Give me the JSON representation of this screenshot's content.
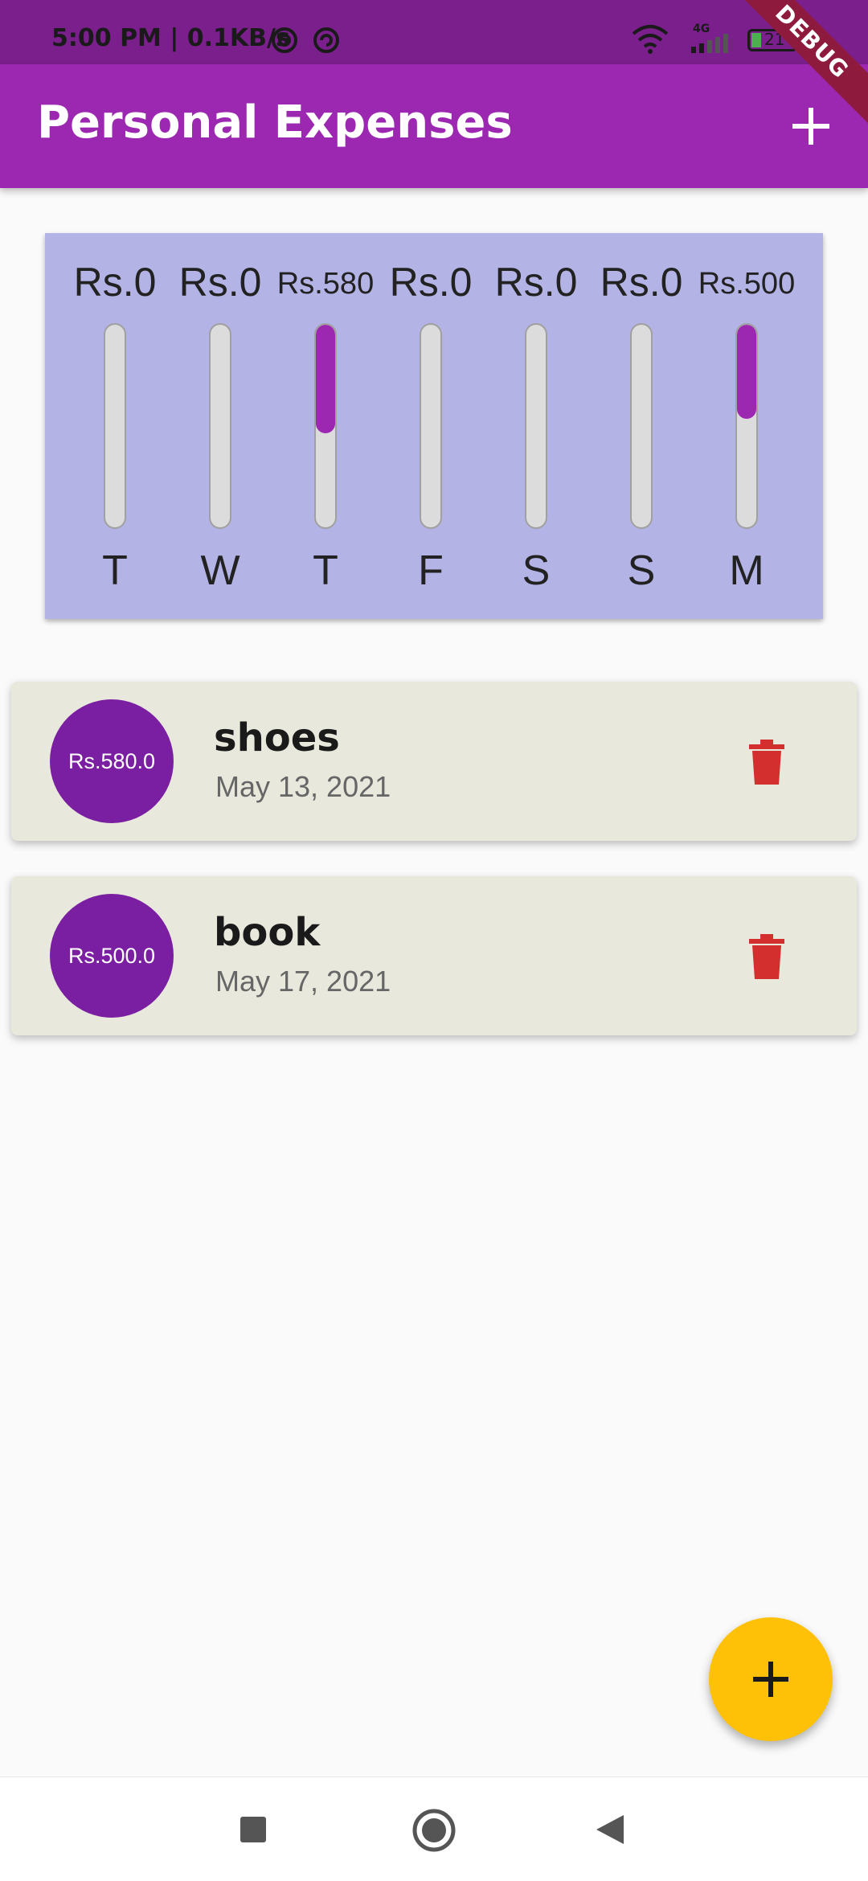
{
  "status_bar": {
    "time": "5:00 PM | 0.1KB/s",
    "network": "4G",
    "battery": "21",
    "icons": [
      "vpn-icon",
      "sync-icon",
      "wifi-icon",
      "signal-icon",
      "battery-icon"
    ]
  },
  "debug_banner": "DEBUG",
  "app_bar": {
    "title": "Personal Expenses",
    "add_icon": "plus-icon"
  },
  "chart": {
    "bars": [
      {
        "day": "T",
        "amount": "Rs.0",
        "value": 0,
        "fraction": 0
      },
      {
        "day": "W",
        "amount": "Rs.0",
        "value": 0,
        "fraction": 0
      },
      {
        "day": "T",
        "amount": "Rs.580",
        "value": 580,
        "fraction": 0.537
      },
      {
        "day": "F",
        "amount": "Rs.0",
        "value": 0,
        "fraction": 0
      },
      {
        "day": "S",
        "amount": "Rs.0",
        "value": 0,
        "fraction": 0
      },
      {
        "day": "S",
        "amount": "Rs.0",
        "value": 0,
        "fraction": 0
      },
      {
        "day": "M",
        "amount": "Rs.500",
        "value": 500,
        "fraction": 0.463
      }
    ],
    "colors": {
      "background": "#b3b3e6",
      "fill": "#9c27b0",
      "track": "#dcdcdc"
    }
  },
  "transactions": [
    {
      "amount": "Rs.580.0",
      "title": "shoes",
      "date": "May 13, 2021",
      "icon": "trash-icon"
    },
    {
      "amount": "Rs.500.0",
      "title": "book",
      "date": "May 17, 2021",
      "icon": "trash-icon"
    }
  ],
  "fab": {
    "icon": "plus-icon",
    "color": "#ffc107"
  },
  "nav_bar": {
    "icons": [
      "recents-square-icon",
      "home-circle-icon",
      "back-triangle-icon"
    ]
  },
  "colors": {
    "primary": "#9c27b0",
    "avatar": "#7b1fa2",
    "delete": "#d32f2f",
    "status_bar": "#7b1f8d"
  }
}
